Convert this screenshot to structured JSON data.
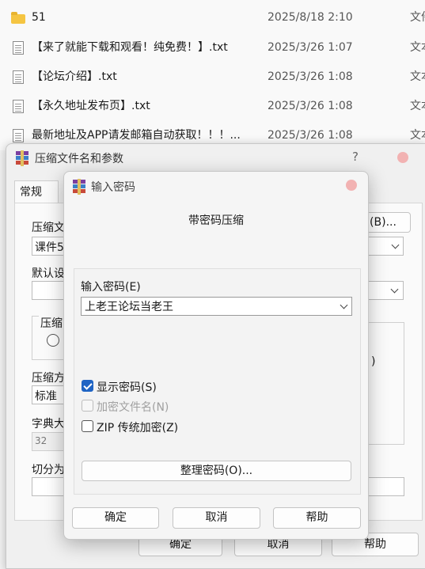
{
  "explorer": {
    "files": [
      {
        "icon": "folder-icon",
        "name": "51",
        "date": "2025/8/18 2:10",
        "type": "文件"
      },
      {
        "icon": "text-file-icon",
        "name": "【来了就能下载和观看！纯免费！】.txt",
        "date": "2025/3/26 1:07",
        "type": "文本"
      },
      {
        "icon": "text-file-icon",
        "name": "【论坛介绍】.txt",
        "date": "2025/3/26 1:08",
        "type": "文本"
      },
      {
        "icon": "text-file-icon",
        "name": "【永久地址发布页】.txt",
        "date": "2025/3/26 1:08",
        "type": "文本"
      },
      {
        "icon": "text-file-icon",
        "name": "最新地址及APP请发邮箱自动获取！！！...",
        "date": "2025/3/26 1:08",
        "type": "文本"
      }
    ]
  },
  "archive_dialog": {
    "title": "压缩文件名和参数",
    "help_symbol": "?",
    "tab_general": "常规",
    "archive_name_label": "压缩文",
    "browse_button": "(B)...",
    "archive_name_value": "课件5",
    "default_profile_label": "默认设",
    "format_group_label": "压缩",
    "method_label": "压缩方",
    "method_value": "标准",
    "dict_label": "字典大",
    "dict_value": "32",
    "split_label": "切分为",
    "radio_fragment": ")",
    "ok_button": "确定",
    "cancel_button": "取消",
    "help_button": "帮助"
  },
  "password_dialog": {
    "title": "输入密码",
    "heading": "带密码压缩",
    "password_label": "输入密码(E)",
    "password_value": "上老王论坛当老王",
    "show_password": {
      "label": "显示密码(S)",
      "checked": true
    },
    "encrypt_filenames": {
      "label": "加密文件名(N)",
      "checked": false,
      "disabled": true
    },
    "zip_legacy": {
      "label": "ZIP 传统加密(Z)",
      "checked": false
    },
    "organize_button": "整理密码(O)...",
    "ok_button": "确定",
    "cancel_button": "取消",
    "help_button": "帮助"
  },
  "colors": {
    "accent": "#1f64c4",
    "close_dot": "#f2b2b2",
    "folder": "#f5c542"
  }
}
